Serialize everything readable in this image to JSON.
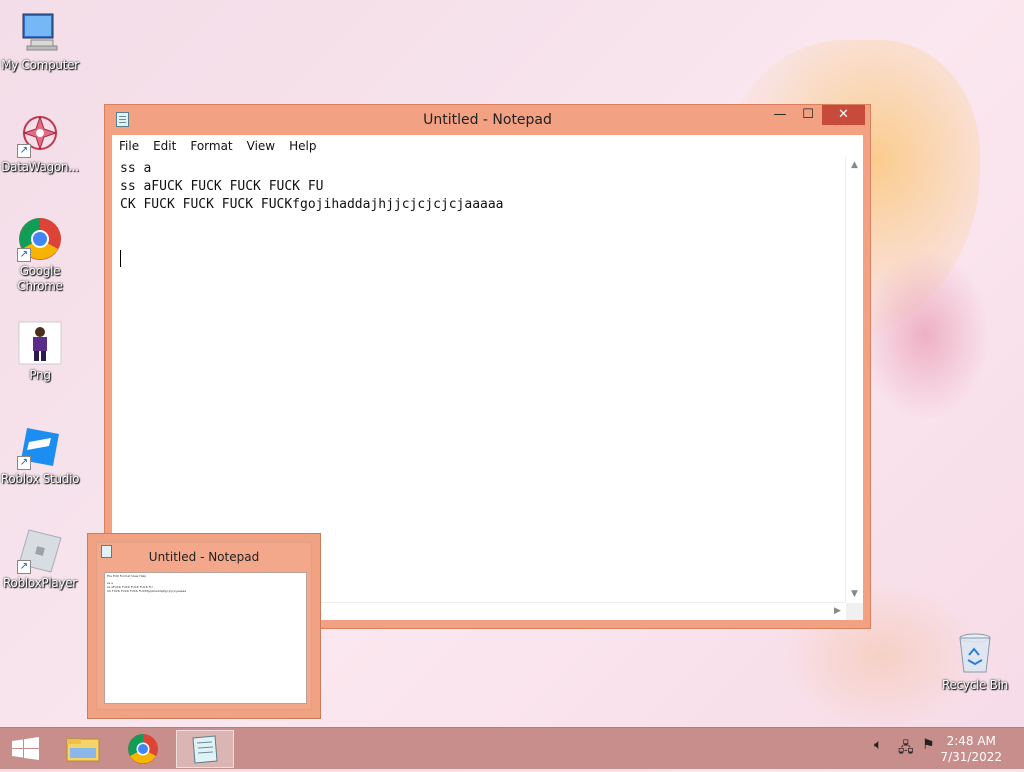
{
  "desktop": {
    "icons": [
      {
        "label": "My Computer",
        "icon": "computer-icon"
      },
      {
        "label": "DataWagon...",
        "icon": "datawagon-icon"
      },
      {
        "label": "Google Chrome",
        "icon": "chrome-icon"
      },
      {
        "label": "Png",
        "icon": "png-file-icon"
      },
      {
        "label": "Roblox Studio",
        "icon": "roblox-studio-icon"
      },
      {
        "label": "RobloxPlayer",
        "icon": "roblox-player-icon"
      },
      {
        "label": "Recycle Bin",
        "icon": "recycle-bin-icon"
      }
    ]
  },
  "notepad": {
    "title": "Untitled - Notepad",
    "menu": [
      "File",
      "Edit",
      "Format",
      "View",
      "Help"
    ],
    "content": "ss a\nss aFUCK FUCK FUCK FUCK FU\nCK FUCK FUCK FUCK FUCKfgojihaddajhjjcjcjcjcjaaaaa"
  },
  "preview": {
    "title": "Untitled - Notepad",
    "menu": "File  Edit  Format  View  Help",
    "content": "ss a\nss aFUCK FUCK FUCK FUCK FU\nCK FUCK FUCK FUCK FUCKfgojihaddajhjjcjcjcjcjaaaaa"
  },
  "taskbar": {
    "items": [
      "start-icon",
      "file-explorer-icon",
      "chrome-icon",
      "notepad-icon"
    ],
    "clock": {
      "time": "2:48 AM",
      "date": "7/31/2022"
    }
  },
  "colors": {
    "window_frame": "#f3a183",
    "close_button": "#c74a3a",
    "taskbar": "#c88e8b"
  }
}
